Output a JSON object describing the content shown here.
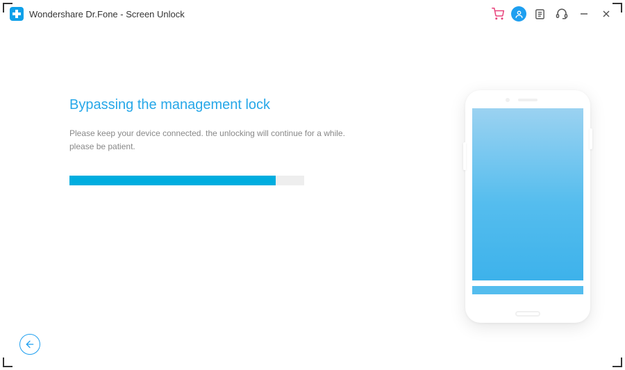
{
  "titlebar": {
    "app_title": "Wondershare Dr.Fone - Screen Unlock"
  },
  "main": {
    "heading": "Bypassing the management lock",
    "subtext_line1": "Please keep your device connected. the unlocking will continue for a while.",
    "subtext_line2": "please be patient.",
    "progress_percent": 88
  },
  "colors": {
    "accent": "#1e9ff0",
    "progress": "#00addf",
    "text_muted": "#888"
  }
}
